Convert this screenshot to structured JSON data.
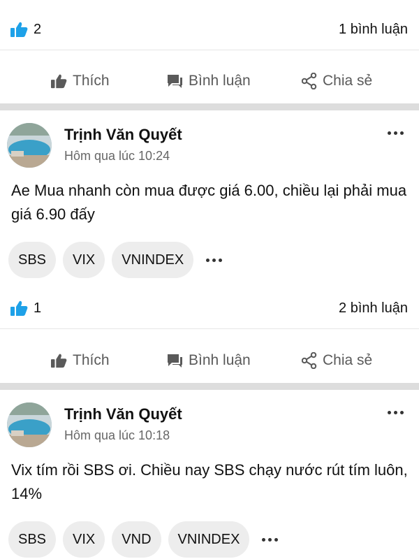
{
  "post1": {
    "like_count": "2",
    "comment_count": "1 bình luận",
    "actions": {
      "like": "Thích",
      "comment": "Bình luận",
      "share": "Chia sẻ"
    }
  },
  "post2": {
    "author": "Trịnh Văn Quyết",
    "time": "Hôm qua lúc 10:24",
    "text": "Ae Mua nhanh còn mua được giá 6.00, chiều lại phải mua giá 6.90 đấy",
    "tags": [
      "SBS",
      "VIX",
      "VNINDEX"
    ],
    "like_count": "1",
    "comment_count": "2 bình luận",
    "actions": {
      "like": "Thích",
      "comment": "Bình luận",
      "share": "Chia sẻ"
    }
  },
  "post3": {
    "author": "Trịnh Văn Quyết",
    "time": "Hôm qua lúc 10:18",
    "text": "Vix tím rồi SBS ơi. Chiều nay SBS chạy nước rút tím luôn, 14%",
    "tags": [
      "SBS",
      "VIX",
      "VND",
      "VNINDEX"
    ]
  },
  "icons": {
    "like_reaction": "thumbs-up-icon",
    "like_action": "thumbs-up-outline-icon",
    "comment_action": "chat-bubble-icon",
    "share_action": "share-icon",
    "more": "more-horizontal-icon"
  },
  "colors": {
    "like_blue": "#1ea1e8",
    "separator": "#dddddd",
    "chip_bg": "#ededed"
  }
}
